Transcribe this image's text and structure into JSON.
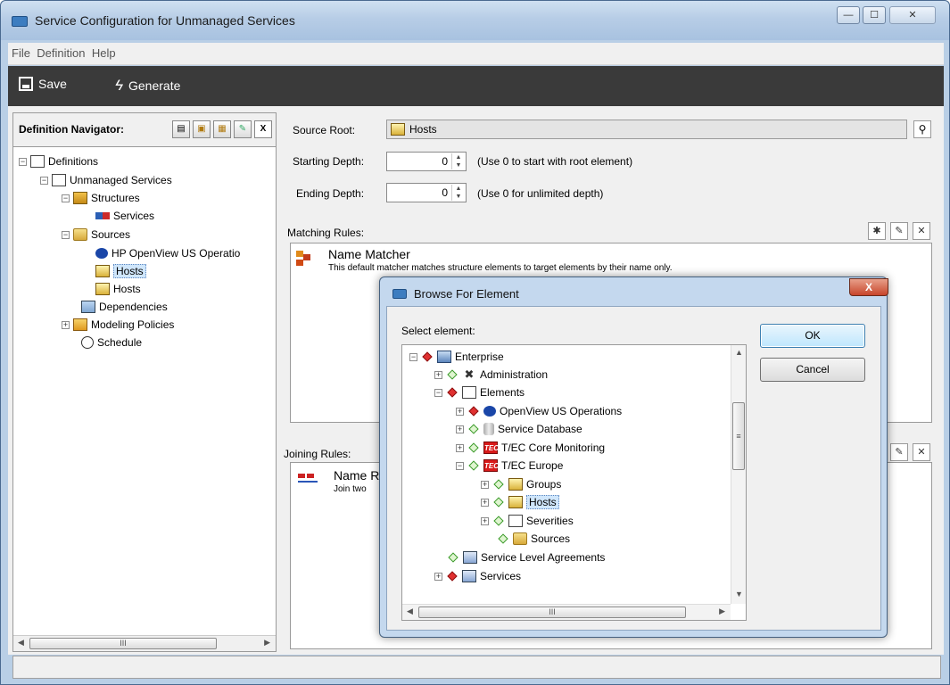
{
  "window": {
    "title": "Service Configuration for Unmanaged Services",
    "controls": {
      "minimize": "—",
      "maximize": "☐",
      "close": "✕"
    }
  },
  "menu": [
    "File",
    "Definition",
    "Help"
  ],
  "toolbar": {
    "save_label": "Save",
    "generate_label": "Generate"
  },
  "navigator": {
    "title": "Definition Navigator:",
    "tree": [
      {
        "label": "Definitions",
        "icon": "definitions-icon"
      },
      {
        "label": "Unmanaged Services",
        "icon": "document-icon"
      },
      {
        "label": "Structures",
        "icon": "structure-icon"
      },
      {
        "label": "Services",
        "icon": "services-icon"
      },
      {
        "label": "Sources",
        "icon": "sources-icon"
      },
      {
        "label": "HP OpenView US Operatio",
        "icon": "openview-icon"
      },
      {
        "label": "Hosts",
        "icon": "hosts-icon",
        "selected": true
      },
      {
        "label": "Hosts",
        "icon": "hosts-icon"
      },
      {
        "label": "Dependencies",
        "icon": "dependencies-icon"
      },
      {
        "label": "Modeling Policies",
        "icon": "policies-icon"
      },
      {
        "label": "Schedule",
        "icon": "clock-icon"
      }
    ],
    "hscroll_thumb": "III"
  },
  "source": {
    "source_root_label": "Source Root:",
    "source_root_value": "Hosts",
    "starting_depth_label": "Starting Depth:",
    "starting_depth_value": "0",
    "starting_depth_hint": "(Use 0 to start with root element)",
    "ending_depth_label": "Ending Depth:",
    "ending_depth_value": "0",
    "ending_depth_hint": "(Use 0 for unlimited depth)"
  },
  "matching": {
    "label": "Matching Rules:",
    "rule_name": "Name Matcher",
    "rule_desc": "This default matcher matches structure elements to target elements by their name only."
  },
  "joining": {
    "label": "Joining Rules:",
    "rule_name": "Name R",
    "rule_desc": "Join two"
  },
  "dialog": {
    "title": "Browse For Element",
    "close": "X",
    "select_label": "Select element:",
    "ok": "OK",
    "cancel": "Cancel",
    "hscroll_thumb": "III",
    "vscroll_thumb": "≡",
    "tree": [
      {
        "label": "Enterprise",
        "status": "red"
      },
      {
        "label": "Administration",
        "status": "green"
      },
      {
        "label": "Elements",
        "status": "red"
      },
      {
        "label": "OpenView US Operations",
        "status": "red"
      },
      {
        "label": "Service Database",
        "status": "green"
      },
      {
        "label": "T/EC Core Monitoring",
        "status": "green"
      },
      {
        "label": "T/EC Europe",
        "status": "green"
      },
      {
        "label": "Groups",
        "status": "green"
      },
      {
        "label": "Hosts",
        "status": "green",
        "selected": true
      },
      {
        "label": "Severities",
        "status": "green"
      },
      {
        "label": "Sources",
        "status": "green"
      },
      {
        "label": "Service Level Agreements",
        "status": "green"
      },
      {
        "label": "Services",
        "status": "red"
      }
    ]
  },
  "colors": {
    "titlebar": "#b9cfe6",
    "toolbar": "#3a3a3a",
    "selection": "#cfe6fb",
    "status_red": "#e03030",
    "status_green": "#3a9a2a"
  }
}
